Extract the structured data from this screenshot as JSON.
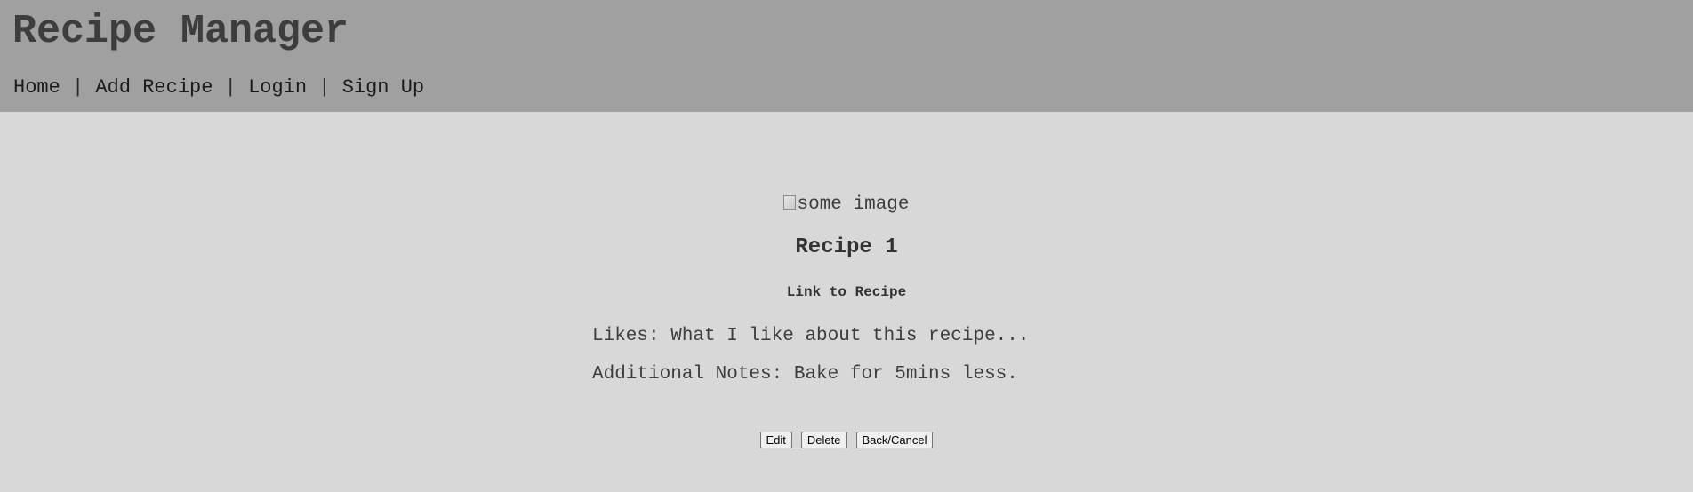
{
  "app": {
    "title": "Recipe Manager"
  },
  "nav": {
    "items": [
      {
        "label": "Home"
      },
      {
        "label": "Add Recipe"
      },
      {
        "label": "Login"
      },
      {
        "label": "Sign Up"
      }
    ],
    "separator": "|"
  },
  "recipe": {
    "image_alt": "some image",
    "title": "Recipe 1",
    "link_label": "Link to Recipe",
    "likes": "Likes: What I like about this recipe...",
    "notes": "Additional Notes: Bake for 5mins less."
  },
  "actions": {
    "edit_label": "Edit",
    "delete_label": "Delete",
    "back_label": "Back/Cancel"
  },
  "colors": {
    "header_bg": "#a0a0a0",
    "page_bg": "#d8d8d8",
    "title_text": "#3d3d3d"
  }
}
